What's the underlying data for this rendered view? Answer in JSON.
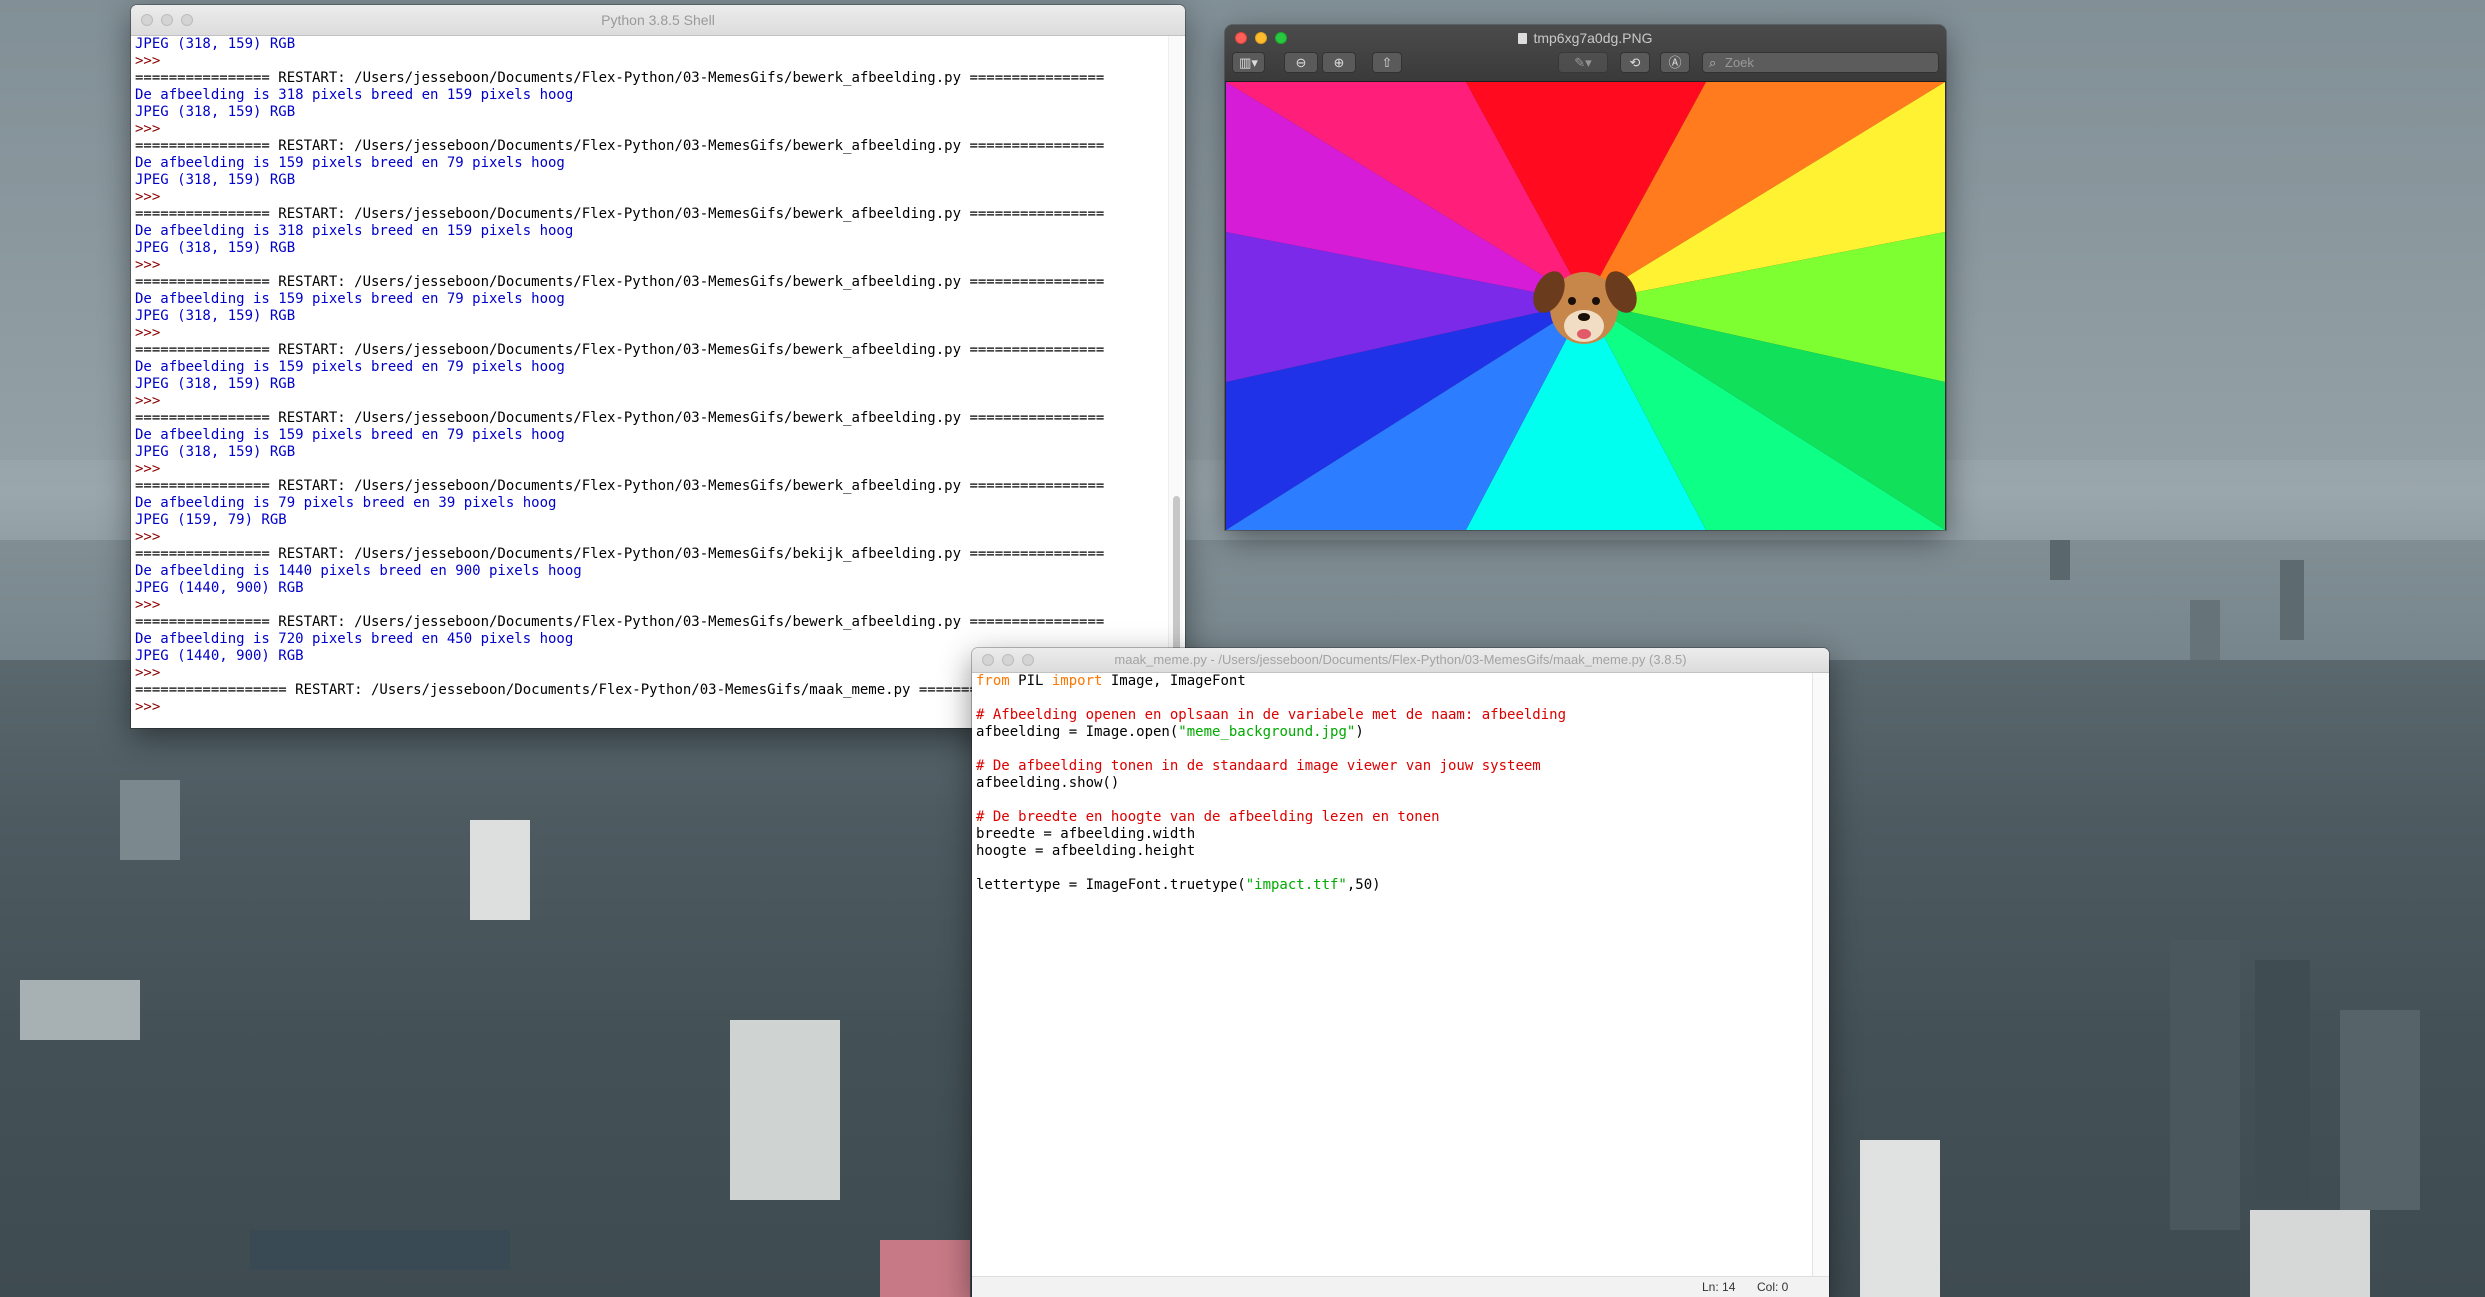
{
  "shell": {
    "title": "Python 3.8.5 Shell",
    "lines": [
      {
        "kind": "out",
        "text": "JPEG (318, 159) RGB"
      },
      {
        "kind": "prompt",
        "text": ">>>"
      },
      {
        "kind": "restart",
        "text": "================ RESTART: /Users/jesseboon/Documents/Flex-Python/03-MemesGifs/bewerk_afbeelding.py ================"
      },
      {
        "kind": "out",
        "text": "De afbeelding is 318 pixels breed en 159 pixels hoog"
      },
      {
        "kind": "out",
        "text": "JPEG (318, 159) RGB"
      },
      {
        "kind": "prompt",
        "text": ">>>"
      },
      {
        "kind": "restart",
        "text": "================ RESTART: /Users/jesseboon/Documents/Flex-Python/03-MemesGifs/bewerk_afbeelding.py ================"
      },
      {
        "kind": "out",
        "text": "De afbeelding is 159 pixels breed en 79 pixels hoog"
      },
      {
        "kind": "out",
        "text": "JPEG (318, 159) RGB"
      },
      {
        "kind": "prompt",
        "text": ">>>"
      },
      {
        "kind": "restart",
        "text": "================ RESTART: /Users/jesseboon/Documents/Flex-Python/03-MemesGifs/bewerk_afbeelding.py ================"
      },
      {
        "kind": "out",
        "text": "De afbeelding is 318 pixels breed en 159 pixels hoog"
      },
      {
        "kind": "out",
        "text": "JPEG (318, 159) RGB"
      },
      {
        "kind": "prompt",
        "text": ">>>"
      },
      {
        "kind": "restart",
        "text": "================ RESTART: /Users/jesseboon/Documents/Flex-Python/03-MemesGifs/bewerk_afbeelding.py ================"
      },
      {
        "kind": "out",
        "text": "De afbeelding is 159 pixels breed en 79 pixels hoog"
      },
      {
        "kind": "out",
        "text": "JPEG (318, 159) RGB"
      },
      {
        "kind": "prompt",
        "text": ">>>"
      },
      {
        "kind": "restart",
        "text": "================ RESTART: /Users/jesseboon/Documents/Flex-Python/03-MemesGifs/bewerk_afbeelding.py ================"
      },
      {
        "kind": "out",
        "text": "De afbeelding is 159 pixels breed en 79 pixels hoog"
      },
      {
        "kind": "out",
        "text": "JPEG (318, 159) RGB"
      },
      {
        "kind": "prompt",
        "text": ">>>"
      },
      {
        "kind": "restart",
        "text": "================ RESTART: /Users/jesseboon/Documents/Flex-Python/03-MemesGifs/bewerk_afbeelding.py ================"
      },
      {
        "kind": "out",
        "text": "De afbeelding is 159 pixels breed en 79 pixels hoog"
      },
      {
        "kind": "out",
        "text": "JPEG (318, 159) RGB"
      },
      {
        "kind": "prompt",
        "text": ">>>"
      },
      {
        "kind": "restart",
        "text": "================ RESTART: /Users/jesseboon/Documents/Flex-Python/03-MemesGifs/bewerk_afbeelding.py ================"
      },
      {
        "kind": "out",
        "text": "De afbeelding is 79 pixels breed en 39 pixels hoog"
      },
      {
        "kind": "out",
        "text": "JPEG (159, 79) RGB"
      },
      {
        "kind": "prompt",
        "text": ">>>"
      },
      {
        "kind": "restart",
        "text": "================ RESTART: /Users/jesseboon/Documents/Flex-Python/03-MemesGifs/bekijk_afbeelding.py ================"
      },
      {
        "kind": "out",
        "text": "De afbeelding is 1440 pixels breed en 900 pixels hoog"
      },
      {
        "kind": "out",
        "text": "JPEG (1440, 900) RGB"
      },
      {
        "kind": "prompt",
        "text": ">>>"
      },
      {
        "kind": "restart",
        "text": "================ RESTART: /Users/jesseboon/Documents/Flex-Python/03-MemesGifs/bewerk_afbeelding.py ================"
      },
      {
        "kind": "out",
        "text": "De afbeelding is 720 pixels breed en 450 pixels hoog"
      },
      {
        "kind": "out",
        "text": "JPEG (1440, 900) RGB"
      },
      {
        "kind": "prompt",
        "text": ">>>"
      },
      {
        "kind": "restart",
        "text": "================== RESTART: /Users/jesseboon/Documents/Flex-Python/03-MemesGifs/maak_meme.py =================="
      },
      {
        "kind": "prompt",
        "text": ">>>"
      }
    ]
  },
  "preview": {
    "title": "tmp6xg7a0dg.PNG",
    "search_placeholder": "Zoek",
    "toolbar_icons": [
      "sidebar-toggle-icon",
      "zoom-out-icon",
      "zoom-in-icon",
      "share-icon",
      "markup-pen-icon",
      "rotate-icon",
      "annotate-icon",
      "search-icon"
    ]
  },
  "editor": {
    "title": "maak_meme.py - /Users/jesseboon/Documents/Flex-Python/03-MemesGifs/maak_meme.py (3.8.5)",
    "code": [
      [
        {
          "t": "kw",
          "v": "from"
        },
        {
          "t": "plain",
          "v": " PIL "
        },
        {
          "t": "kw",
          "v": "import"
        },
        {
          "t": "plain",
          "v": " Image, ImageFont"
        }
      ],
      [],
      [
        {
          "t": "com",
          "v": "# Afbeelding openen en oplsaan in de variabele met de naam: afbeelding"
        }
      ],
      [
        {
          "t": "plain",
          "v": "afbeelding = Image.open("
        },
        {
          "t": "str",
          "v": "\"meme_background.jpg\""
        },
        {
          "t": "plain",
          "v": ")"
        }
      ],
      [],
      [
        {
          "t": "com",
          "v": "# De afbeelding tonen in de standaard image viewer van jouw systeem"
        }
      ],
      [
        {
          "t": "plain",
          "v": "afbeelding.show()"
        }
      ],
      [],
      [
        {
          "t": "com",
          "v": "# De breedte en hoogte van de afbeelding lezen en tonen"
        }
      ],
      [
        {
          "t": "plain",
          "v": "breedte = afbeelding.width"
        }
      ],
      [
        {
          "t": "plain",
          "v": "hoogte = afbeelding.height"
        }
      ],
      [],
      [
        {
          "t": "plain",
          "v": "lettertype = ImageFont.truetype("
        },
        {
          "t": "str",
          "v": "\"impact.ttf\""
        },
        {
          "t": "plain",
          "v": ",50)"
        }
      ]
    ],
    "status_line": "Ln: 14",
    "status_col": "Col: 0"
  },
  "colors": {
    "shell_output": "#0000c8",
    "shell_prompt": "#8a0000",
    "keyword": "#ff7700",
    "comment": "#dd0000",
    "string": "#00aa00"
  }
}
